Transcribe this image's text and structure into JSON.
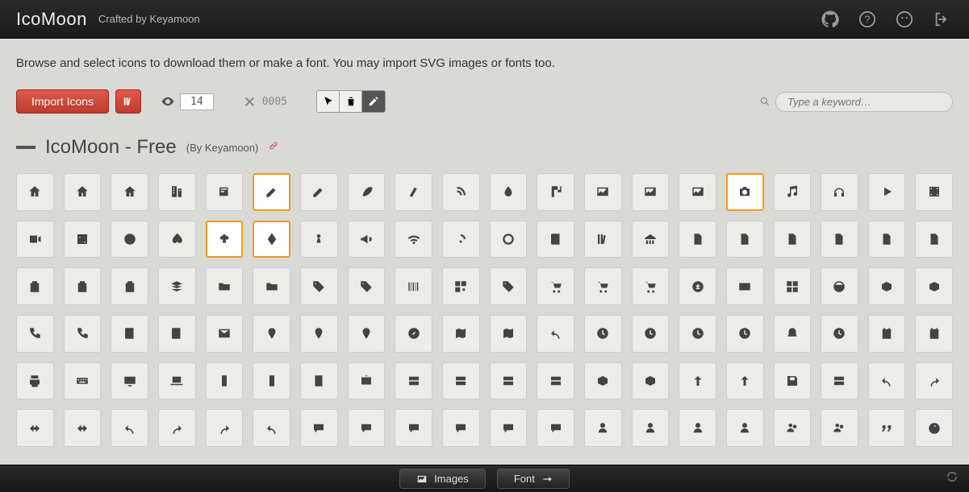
{
  "header": {
    "logo": "IcoMoon",
    "crafted_prefix": "Crafted by ",
    "crafted_name": "Keyamoon"
  },
  "intro": "Browse and select icons to download them or make a font. You may import SVG images or fonts too.",
  "toolbar": {
    "import_label": "Import Icons",
    "visible_count": "14",
    "selected_code": "0005",
    "search_placeholder": "Type a keyword…"
  },
  "set": {
    "name": "IcoMoon - Free",
    "by_prefix": "(By ",
    "by_name": "Keyamoon",
    "by_suffix": ")"
  },
  "selected_icons": [
    "pencil",
    "camera",
    "clubs",
    "diamonds"
  ],
  "icon_rows": [
    [
      "home",
      "home2",
      "home3",
      "office",
      "newspaper",
      "pencil",
      "pencil2",
      "quill",
      "pen",
      "blog",
      "droplet",
      "paint-format",
      "image",
      "image2",
      "images",
      "camera",
      "music",
      "headphones",
      "play",
      "film"
    ],
    [
      "video-camera",
      "dice",
      "pacman",
      "spades",
      "clubs",
      "diamonds",
      "pawn",
      "bullhorn",
      "connection",
      "podcast",
      "feed",
      "book",
      "books",
      "library",
      "file",
      "profile",
      "file-empty",
      "file2",
      "copy",
      "stack"
    ],
    [
      "paste",
      "paste2",
      "paste3",
      "folder",
      "folder-open",
      "tag",
      "tags",
      "barcode",
      "qrcode",
      "ticket",
      "cart",
      "cart2",
      "cart3",
      "coin",
      "credit-card",
      "calculator",
      "support",
      "box-add",
      "box-remove",
      "box"
    ],
    [
      "phone",
      "phone-hang-up",
      "address-book",
      "notebook",
      "envelope",
      "pushpin",
      "location",
      "location2",
      "compass",
      "map",
      "map2",
      "history",
      "clock",
      "clock2",
      "alarm",
      "alarm2",
      "bell",
      "stopwatch",
      "calendar",
      "calendar2"
    ],
    [
      "print",
      "keyboard",
      "screen",
      "laptop",
      "mobile",
      "mobile2",
      "tablet",
      "tv",
      "cabinet",
      "drawer",
      "drawer2",
      "drawer3",
      "box-add2",
      "box-remove2",
      "download",
      "upload",
      "disk",
      "storage",
      "undo",
      "redo"
    ],
    [
      "flip",
      "flip2",
      "undo2",
      "redo2",
      "forward",
      "reply",
      "bubble",
      "bubble2",
      "bubbles",
      "bubbles2",
      "bubbles3",
      "bubbles4",
      "user",
      "user2",
      "user3",
      "user4",
      "users",
      "users2",
      "quotes-left",
      "busy"
    ]
  ],
  "bottombar": {
    "images_label": "Images",
    "font_label": "Font"
  }
}
